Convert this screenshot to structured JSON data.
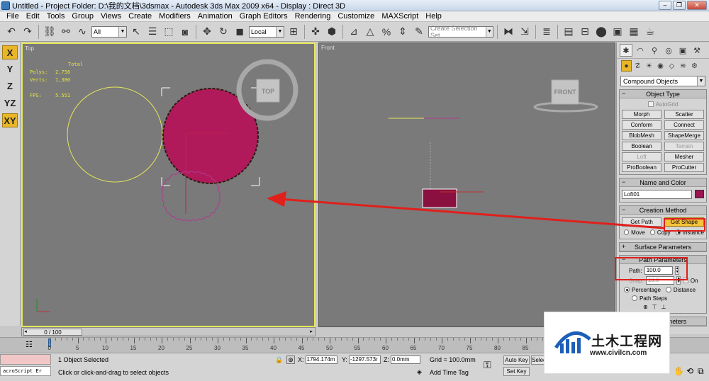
{
  "window": {
    "title": "Untitled    - Project Folder: D:\\我的文档\\3dsmax    - Autodesk 3ds Max  2009 x64    - Display : Direct 3D",
    "minimize": "–",
    "restore": "❐",
    "close": "✕"
  },
  "menu": [
    "File",
    "Edit",
    "Tools",
    "Group",
    "Views",
    "Create",
    "Modifiers",
    "Animation",
    "Graph Editors",
    "Rendering",
    "Customize",
    "MAXScript",
    "Help"
  ],
  "toolbar": {
    "selection_filter": "All",
    "ref_coord": "Local",
    "named_selection_placeholder": "Create Selection Set"
  },
  "viewport_tools": [
    "X",
    "Y",
    "Z",
    "YZ",
    "XY"
  ],
  "viewports": {
    "top": {
      "label": "Top",
      "stats_header": "Total",
      "polys_label": "Polys:",
      "polys_value": "2,756",
      "verts_label": "Verts:",
      "verts_value": "1,380",
      "fps_label": "FPS:",
      "fps_value": "5.551",
      "viewcube_label": "TOP"
    },
    "front": {
      "label": "Front",
      "viewcube_label": "FRONT"
    }
  },
  "command_panel": {
    "category_dropdown": "Compound Objects",
    "object_type": {
      "header": "Object Type",
      "autogrid_label": "AutoGrid",
      "buttons": [
        "Morph",
        "Scatter",
        "Conform",
        "Connect",
        "BlobMesh",
        "ShapeMerge",
        "Boolean",
        "Terrain",
        "Loft",
        "Mesher",
        "ProBoolean",
        "ProCutter"
      ]
    },
    "name_color": {
      "header": "Name and Color",
      "name_value": "Loft01",
      "color": "#9c1450"
    },
    "creation_method": {
      "header": "Creation Method",
      "get_path": "Get Path",
      "get_shape": "Get Shape",
      "move": "Move",
      "copy": "Copy",
      "instance": "Instance"
    },
    "surface_params_header": "Surface Parameters",
    "path_params": {
      "header": "Path Parameters",
      "path_label": "Path:",
      "path_value": "100.0",
      "snap_label": "Snap:",
      "snap_value": "10.0",
      "on_label": "On",
      "percentage": "Percentage",
      "distance": "Distance",
      "path_steps": "Path Steps"
    },
    "skin_params_header": "Skin Parameters"
  },
  "time_slider": {
    "label": "0 / 100"
  },
  "track_ticks": [
    "0",
    "5",
    "10",
    "15",
    "20",
    "25",
    "30",
    "35",
    "40",
    "45",
    "50",
    "55",
    "60",
    "65",
    "70",
    "75",
    "80",
    "85",
    "90",
    "95",
    "100"
  ],
  "status": {
    "maxscript_label": "acroScript Er",
    "selection": "1 Object Selected",
    "prompt": "Click or click-and-drag to select objects",
    "x_label": "X:",
    "x_value": "1794.174m",
    "y_label": "Y:",
    "y_value": "-1297.573r",
    "z_label": "Z:",
    "z_value": "0.0mm",
    "grid": "Grid = 100.0mm",
    "add_time_tag": "Add Time Tag",
    "auto_key": "Auto Key",
    "set_key": "Set Key",
    "selected": "Selected"
  },
  "watermark": {
    "text": "土木工程网",
    "url": "www.civilcn.com"
  }
}
